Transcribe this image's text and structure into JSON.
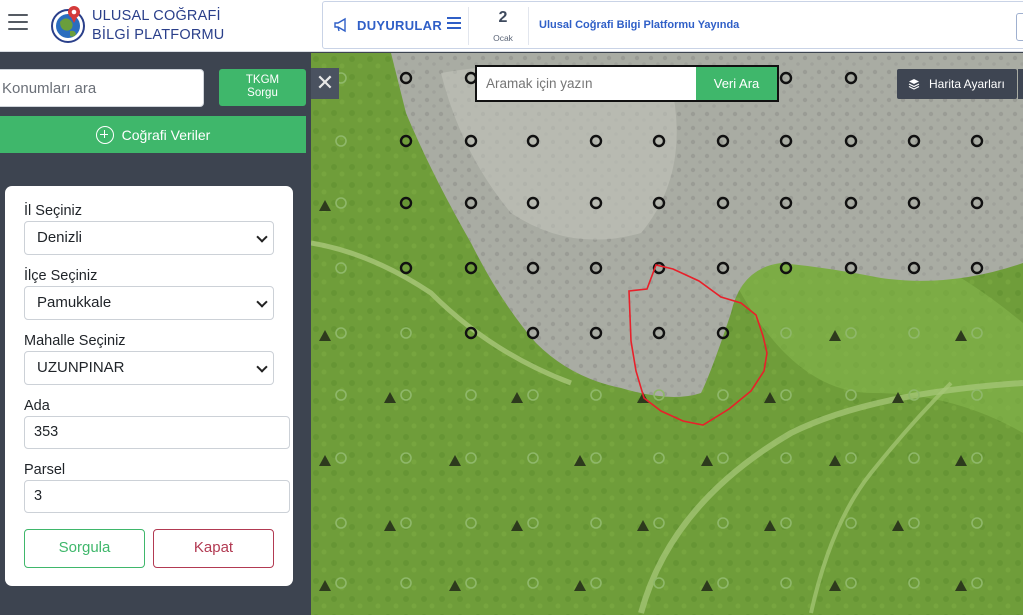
{
  "header": {
    "brand_line1": "ULUSAL COĞRAFİ",
    "brand_line2": "BİLGİ PLATFORMU",
    "announcements_label": "DUYURULAR",
    "ann_day": "2",
    "ann_month": "Ocak",
    "ann_text": "Ulusal Coğrafi Bilgi Platformu Yayında"
  },
  "sidebar": {
    "location_placeholder": "Konumları ara",
    "tkgm_line1": "TKGM",
    "tkgm_line2": "Sorgu",
    "geo_data_label": "Coğrafi Veriler"
  },
  "form": {
    "il_label": "İl Seçiniz",
    "il_value": "Denizli",
    "ilce_label": "İlçe Seçiniz",
    "ilce_value": "Pamukkale",
    "mahalle_label": "Mahalle Seçiniz",
    "mahalle_value": "UZUNPINAR",
    "ada_label": "Ada",
    "ada_value": "353",
    "parsel_label": "Parsel",
    "parsel_value": "3",
    "query_button": "Sorgula",
    "close_button": "Kapat"
  },
  "map": {
    "close_glyph": "✕",
    "search_placeholder": "Aramak için yazın",
    "search_button": "Veri Ara",
    "settings_label": "Harita Ayarları"
  },
  "colors": {
    "accent_green": "#3fb76b",
    "brand_blue": "#2a3f8a",
    "announce_blue": "#2f5fc7",
    "danger": "#b23a52",
    "panel_dark": "#3d4450",
    "parcel_outline": "#e8202a"
  }
}
